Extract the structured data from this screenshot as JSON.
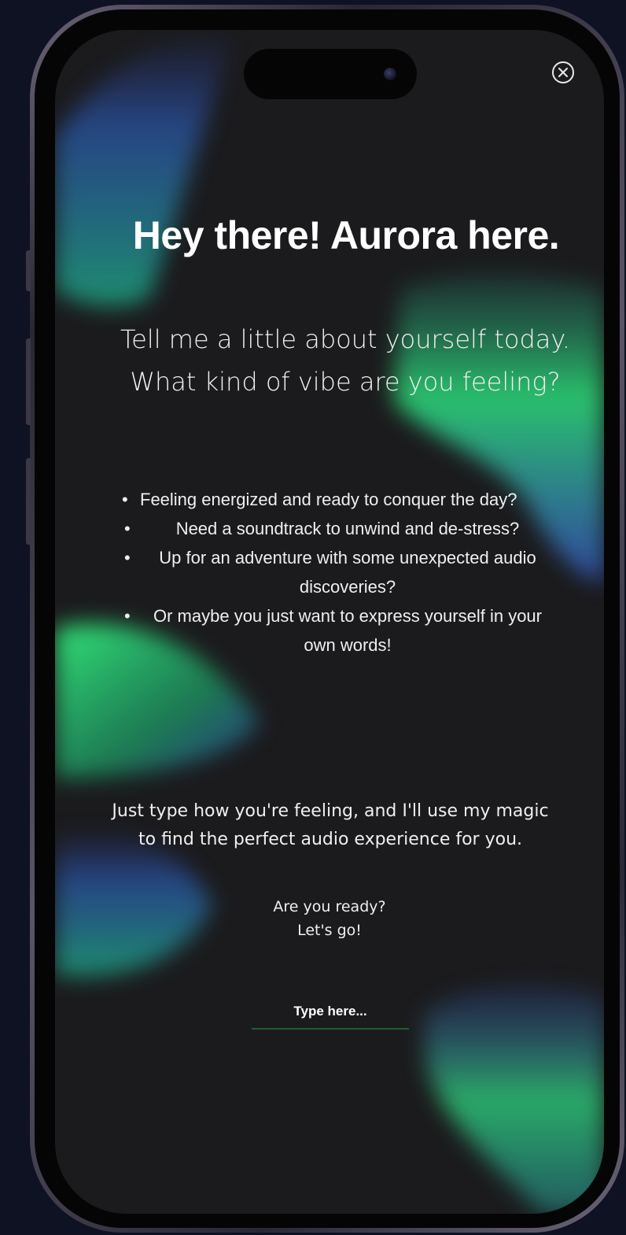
{
  "app": {
    "colors": {
      "background": "#1b1b1d",
      "aurora_green": "#2ee07a",
      "aurora_blue": "#3a6fd8",
      "input_underline": "#1f5e30"
    }
  },
  "header": {
    "close_icon": "close-circle-icon"
  },
  "main": {
    "title": "Hey there! Aurora here.",
    "subtitle_line1": "Tell me a little about yourself today.",
    "subtitle_line2": "What kind of vibe are you feeling?",
    "options": [
      "Feeling energized and ready to conquer the day?",
      "Need a soundtrack to unwind and de-stress?",
      "Up for an adventure with some unexpected audio discoveries?",
      "Or maybe you just want to express yourself in your own words!"
    ],
    "instruction": "Just type how you're feeling, and I'll use my magic to find the perfect audio experience for you.",
    "ready_line1": "Are you ready?",
    "ready_line2": "Let's go!",
    "input": {
      "placeholder": "Type here...",
      "value": ""
    }
  }
}
